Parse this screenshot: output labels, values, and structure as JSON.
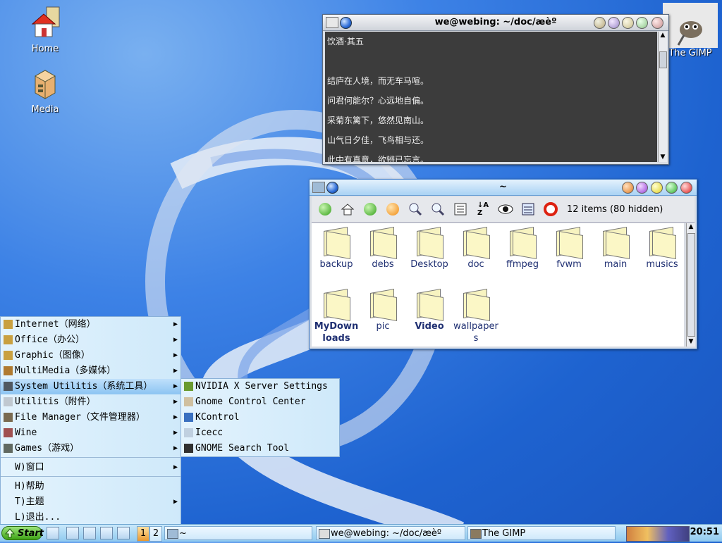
{
  "desktop": {
    "icons": [
      {
        "label": "Home"
      },
      {
        "label": "Media"
      },
      {
        "label": "The GIMP"
      }
    ]
  },
  "terminal": {
    "title": "we@webing: ~/doc/æèº",
    "lines": [
      "饮酒·其五",
      "",
      "结庐在人境，而无车马喧。",
      "问君何能尔？心远地自偏。",
      "采菊东篱下，悠然见南山。",
      "山气日夕佳，飞鸟相与还。",
      "此中有真意，欲辨已忘言。"
    ]
  },
  "file_manager": {
    "title": "~",
    "status": "12 items (80 hidden)",
    "folders": [
      "backup",
      "debs",
      "Desktop",
      "doc",
      "ffmpeg",
      "fvwm",
      "main",
      "musics",
      "MyDown\nloads",
      "pic",
      "Video",
      "wallpaper\ns"
    ]
  },
  "start_menu": {
    "items": [
      {
        "label": "Internet（网络）",
        "submenu": true
      },
      {
        "label": "Office（办公）",
        "submenu": true
      },
      {
        "label": "Graphic（图像）",
        "submenu": true
      },
      {
        "label": "MultiMedia（多媒体）",
        "submenu": true
      },
      {
        "label": "System Utilitis（系统工具）",
        "submenu": true
      },
      {
        "label": "Utilitis（附件）",
        "submenu": true
      },
      {
        "label": "File Manager（文件管理器）",
        "submenu": true
      },
      {
        "label": "Wine",
        "submenu": true
      },
      {
        "label": "Games（游戏）",
        "submenu": true
      },
      {
        "label": "W)窗口",
        "submenu": true
      },
      {
        "label": "H)帮助",
        "submenu": false
      },
      {
        "label": "T)主题",
        "submenu": true
      },
      {
        "label": "L)退出...",
        "submenu": false
      }
    ],
    "submenu": [
      "NVIDIA X Server Settings",
      "Gnome Control Center",
      "KControl",
      "Icecc",
      "GNOME Search Tool"
    ]
  },
  "taskbar": {
    "start_label": "Start",
    "desk1": "1",
    "desk2": "2",
    "path_label": "~",
    "task_terminal": "we@webing: ~/doc/æèº",
    "task_gimp": "The GIMP",
    "clock": "20:51"
  }
}
